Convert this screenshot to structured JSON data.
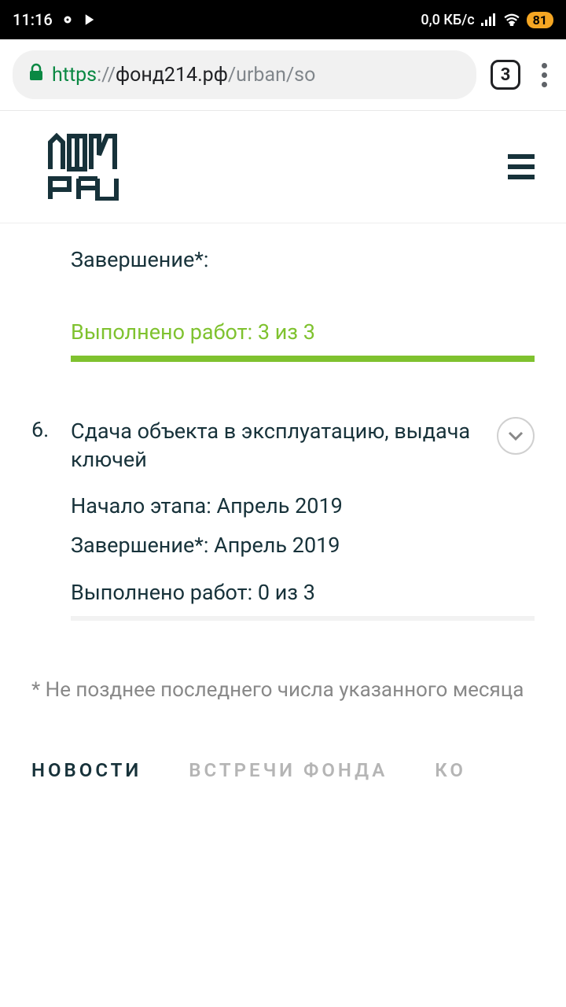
{
  "status_bar": {
    "time": "11:16",
    "speed": "0,0 КБ/с",
    "battery": "81"
  },
  "browser": {
    "url_scheme": "https",
    "url_sep": "://",
    "url_host": "фонд214.рф",
    "url_path": "/urban/so",
    "tab_count": "3"
  },
  "stages": {
    "five": {
      "completion_label": "Завершение*:",
      "works_done": "Выполнено работ: 3 из 3"
    },
    "six": {
      "num": "6.",
      "title": "Сдача объекта в эксплуатацию, выдача ключей",
      "start": "Начало этапа: Апрель 2019",
      "end": "Завершение*: Апрель 2019",
      "works_done": "Выполнено работ: 0 из 3"
    }
  },
  "footnote": "* Не позднее последнего числа указанного месяца",
  "tabs": {
    "news": "НОВОСТИ",
    "meetings": "ВСТРЕЧИ ФОНДА",
    "ko": "КО"
  }
}
